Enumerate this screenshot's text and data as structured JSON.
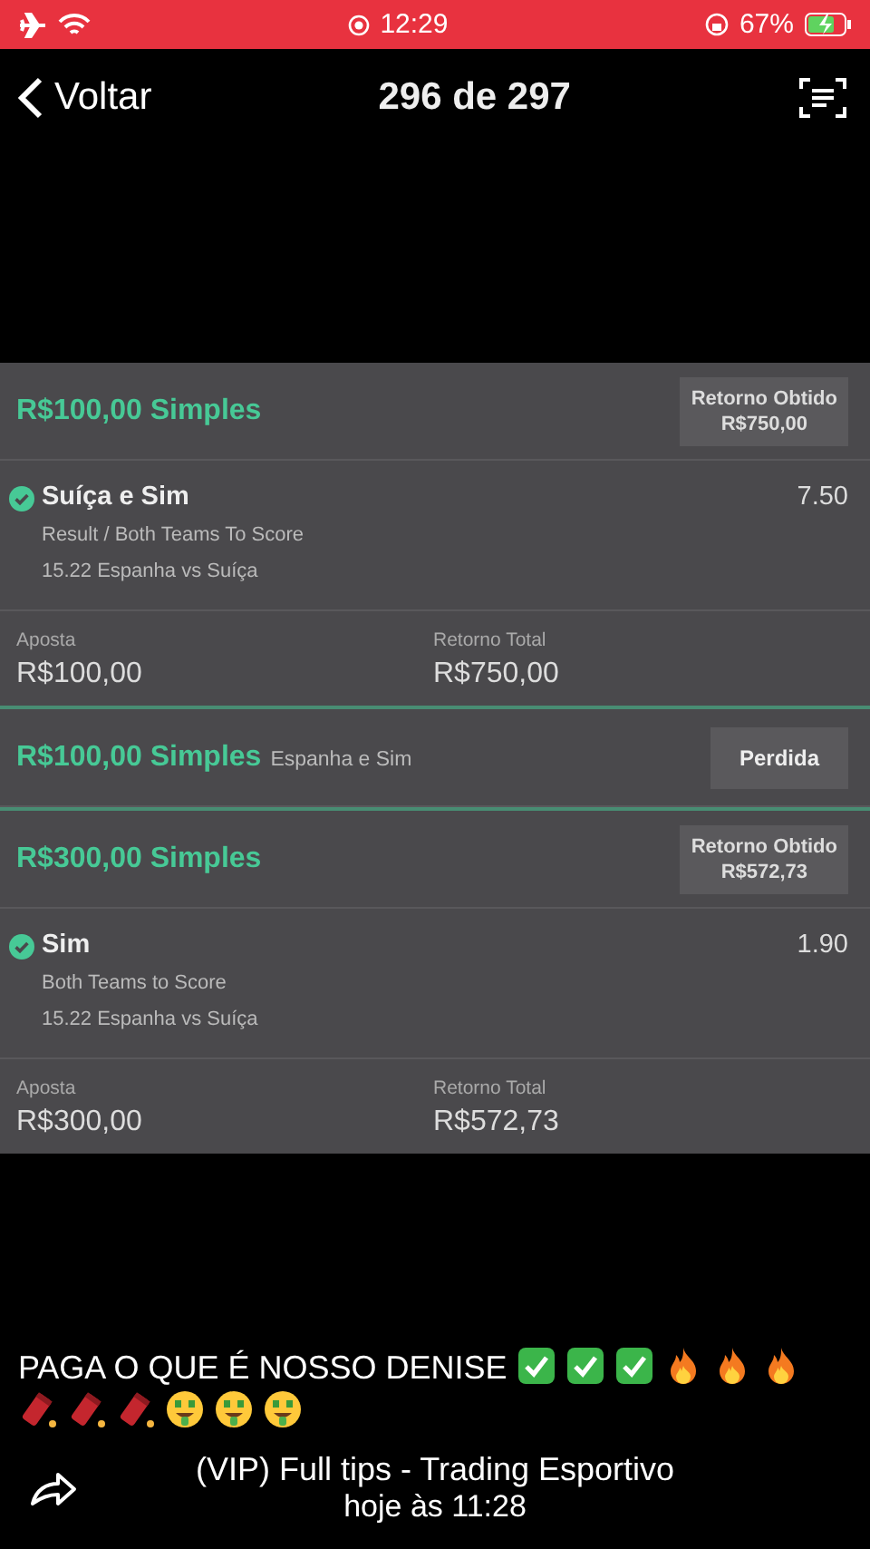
{
  "status_bar": {
    "time": "12:29",
    "battery": "67%"
  },
  "nav": {
    "back": "Voltar",
    "title": "296 de 297"
  },
  "bets": [
    {
      "kind": "expanded",
      "title": "R$100,00 Simples",
      "badge": {
        "label": "Retorno Obtido",
        "value": "R$750,00"
      },
      "selection": {
        "won": true,
        "name": "Suíça e Sim",
        "odds": "7.50",
        "market": "Result / Both Teams To Score",
        "event": "15.22 Espanha vs Suíça"
      },
      "stake": {
        "label": "Aposta",
        "value": "R$100,00"
      },
      "return": {
        "label": "Retorno Total",
        "value": "R$750,00"
      }
    },
    {
      "kind": "collapsed",
      "title": "R$100,00 Simples",
      "subtitle": "Espanha e Sim",
      "status": "Perdida"
    },
    {
      "kind": "expanded",
      "title": "R$300,00 Simples",
      "badge": {
        "label": "Retorno Obtido",
        "value": "R$572,73"
      },
      "selection": {
        "won": true,
        "name": "Sim",
        "odds": "1.90",
        "market": "Both Teams to Score",
        "event": "15.22 Espanha vs Suíça"
      },
      "stake": {
        "label": "Aposta",
        "value": "R$300,00"
      },
      "return": {
        "label": "Retorno Total",
        "value": "R$572,73"
      }
    }
  ],
  "caption": {
    "text": "PAGA O QUE É NOSSO DENISE",
    "emojis": [
      {
        "kind": "check"
      },
      {
        "kind": "check"
      },
      {
        "kind": "check"
      },
      {
        "kind": "fire"
      },
      {
        "kind": "fire"
      },
      {
        "kind": "fire"
      },
      {
        "kind": "firecracker"
      },
      {
        "kind": "firecracker"
      },
      {
        "kind": "firecracker"
      },
      {
        "kind": "money-face"
      },
      {
        "kind": "money-face"
      },
      {
        "kind": "money-face"
      }
    ]
  },
  "footer": {
    "sender": "(VIP) Full tips - Trading Esportivo",
    "time": "hoje às 11:28"
  }
}
